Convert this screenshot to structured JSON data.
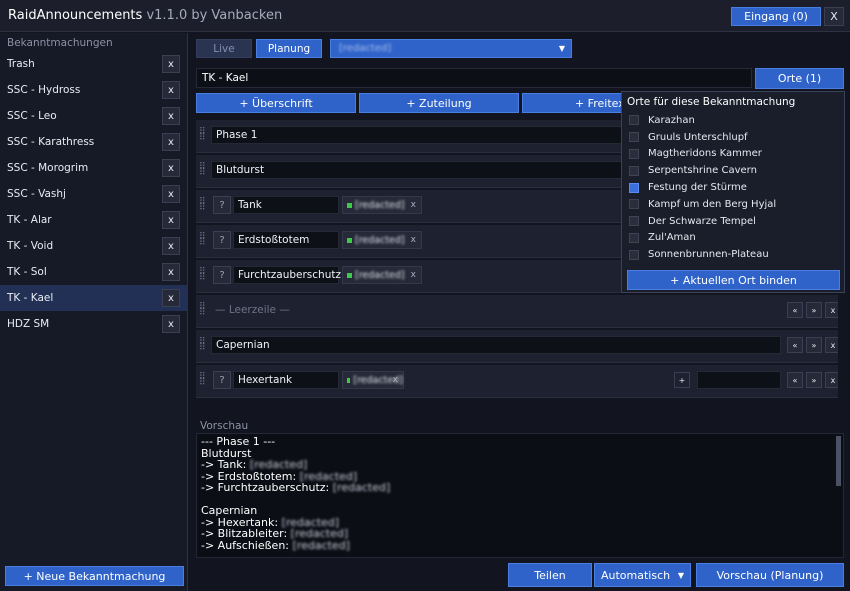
{
  "window": {
    "app_name": "RaidAnnouncements",
    "version_by": " v1.1.0 by Vanbacken",
    "inbox_label": "Eingang (0)",
    "close_label": "X"
  },
  "sidebar": {
    "header": "Bekanntmachungen",
    "items": [
      {
        "label": "Trash",
        "active": false
      },
      {
        "label": "SSC - Hydross",
        "active": false
      },
      {
        "label": "SSC - Leo",
        "active": false
      },
      {
        "label": "SSC - Karathress",
        "active": false
      },
      {
        "label": "SSC - Morogrim",
        "active": false
      },
      {
        "label": "SSC - Vashj",
        "active": false
      },
      {
        "label": "TK - Alar",
        "active": false
      },
      {
        "label": "TK - Void",
        "active": false
      },
      {
        "label": "TK - Sol",
        "active": false
      },
      {
        "label": "TK - Kael",
        "active": true
      },
      {
        "label": "HDZ SM",
        "active": false
      }
    ],
    "remove_label": "x",
    "new_button": "+ Neue Bekanntmachung"
  },
  "main": {
    "tabs": {
      "live": "Live",
      "planning": "Planung"
    },
    "channel_value": "[redacted]",
    "title_value": "TK - Kael",
    "places_button": "Orte (1)",
    "add_buttons": {
      "heading": "+ Überschrift",
      "assignment": "+ Zuteilung",
      "freetext": "+ Freitext"
    },
    "rows": [
      {
        "type": "heading",
        "text": "Phase 1"
      },
      {
        "type": "heading",
        "text": "Blutdurst"
      },
      {
        "type": "assignment",
        "q": "?",
        "role": "Tank",
        "assigned": "[redacted]"
      },
      {
        "type": "assignment",
        "q": "?",
        "role": "Erdstoßtotem",
        "assigned": "[redacted]"
      },
      {
        "type": "assignment",
        "q": "?",
        "role": "Furchtzauberschutz",
        "assigned": "[redacted]"
      },
      {
        "type": "empty",
        "text": "— Leerzeile —"
      },
      {
        "type": "heading",
        "text": "Capernian"
      },
      {
        "type": "assignment",
        "q": "?",
        "role": "Hexertank",
        "assigned": "[redacted]"
      }
    ],
    "row_controls": {
      "up": "«",
      "down": "»",
      "remove": "x",
      "plus": "+",
      "x": "x"
    },
    "preview": {
      "label": "Vorschau",
      "lines": [
        {
          "text": "--- Phase 1 ---",
          "blur": ""
        },
        {
          "text": "Blutdurst",
          "blur": ""
        },
        {
          "text": "-> Tank: ",
          "blur": "[redacted]"
        },
        {
          "text": "-> Erdstoßtotem: ",
          "blur": "[redacted]"
        },
        {
          "text": "-> Furchtzauberschutz: ",
          "blur": "[redacted]"
        },
        {
          "text": "",
          "blur": ""
        },
        {
          "text": "Capernian",
          "blur": ""
        },
        {
          "text": "-> Hexertank: ",
          "blur": "[redacted]"
        },
        {
          "text": "-> Blitzableiter: ",
          "blur": "[redacted]"
        },
        {
          "text": "-> Aufschießen: ",
          "blur": "[redacted]"
        }
      ]
    },
    "footer": {
      "share": "Teilen",
      "mode": "Automatisch",
      "preview_button": "Vorschau (Planung)"
    }
  },
  "places_dropdown": {
    "title": "Orte für diese Bekanntmachung",
    "items": [
      {
        "label": "Karazhan",
        "checked": false
      },
      {
        "label": "Gruuls Unterschlupf",
        "checked": false
      },
      {
        "label": "Magtheridons Kammer",
        "checked": false
      },
      {
        "label": "Serpentshrine Cavern",
        "checked": false
      },
      {
        "label": "Festung der Stürme",
        "checked": true
      },
      {
        "label": "Kampf um den Berg Hyjal",
        "checked": false
      },
      {
        "label": "Der Schwarze Tempel",
        "checked": false
      },
      {
        "label": "Zul'Aman",
        "checked": false
      },
      {
        "label": "Sonnenbrunnen-Plateau",
        "checked": false
      }
    ],
    "bind_button": "+ Aktuellen Ort binden"
  },
  "colors": {
    "accent": "#2f63c9",
    "active_sidebar": "#213054",
    "checked_box": "#3a6fdc",
    "assign_marker": "#3ec94a"
  }
}
